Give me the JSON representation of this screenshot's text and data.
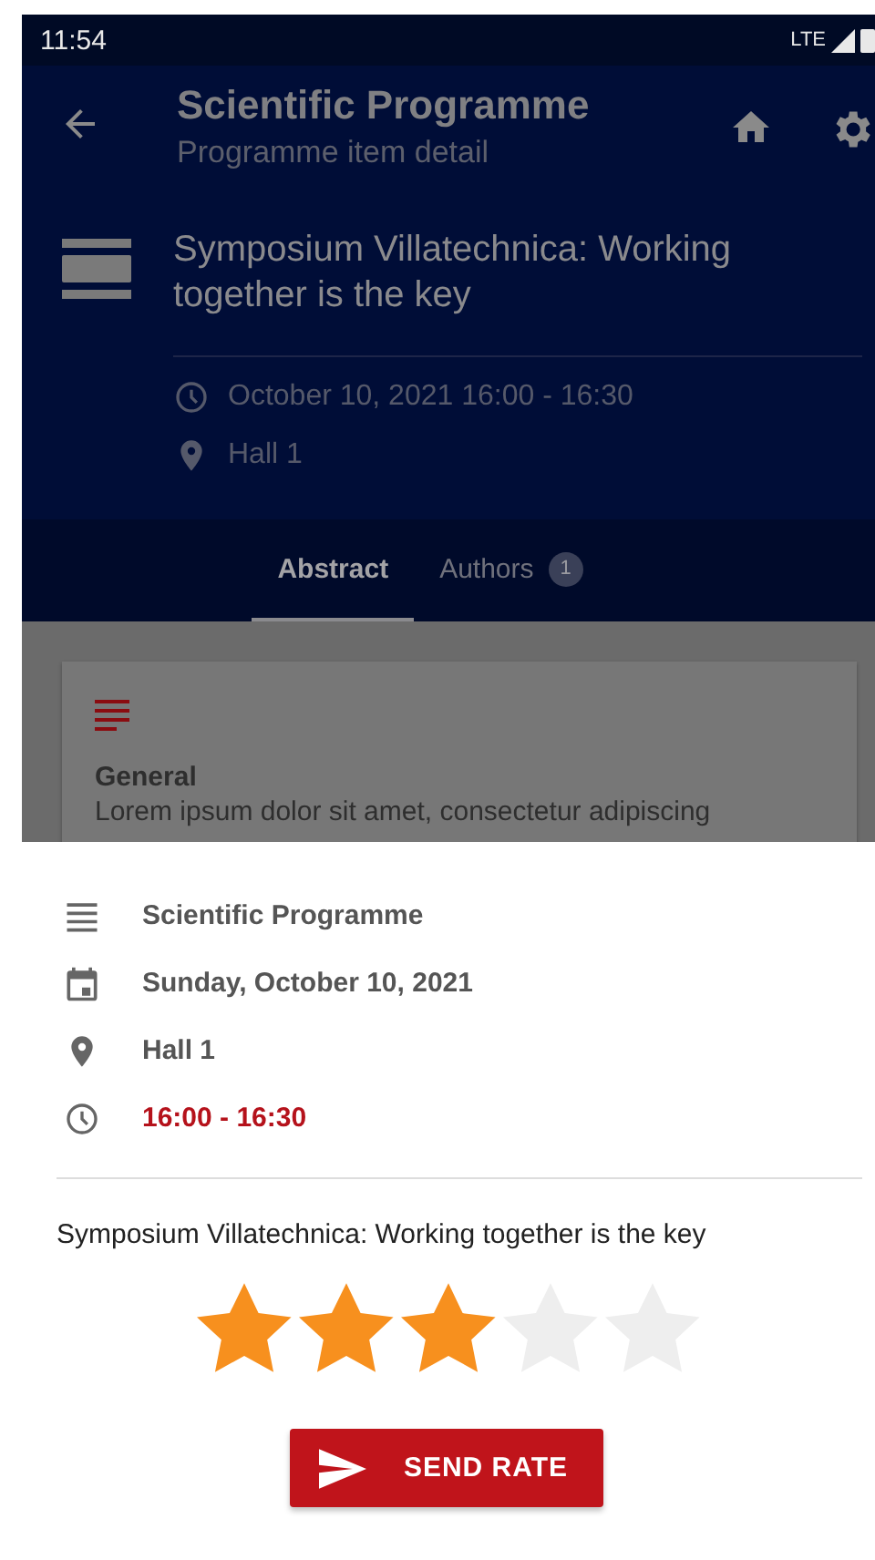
{
  "status_bar": {
    "time": "11:54",
    "network": "LTE"
  },
  "app_bar": {
    "title": "Scientific Programme",
    "subtitle": "Programme item detail"
  },
  "header": {
    "title": "Symposium Villatechnica: Working together is the key",
    "date_time": "October 10, 2021 16:00 - 16:30",
    "location": "Hall 1"
  },
  "tabs": [
    {
      "label": "Abstract",
      "selected": true
    },
    {
      "label": "Authors",
      "selected": false,
      "badge": "1"
    }
  ],
  "card": {
    "heading": "General",
    "text": "Lorem ipsum dolor sit amet, consectetur adipiscing"
  },
  "sheet": {
    "rows": [
      {
        "kind": "programme",
        "text": "Scientific Programme"
      },
      {
        "kind": "date",
        "text": "Sunday, October 10, 2021"
      },
      {
        "kind": "location",
        "text": "Hall 1"
      },
      {
        "kind": "time",
        "text": "16:00 - 16:30"
      }
    ],
    "title": "Symposium Villatechnica: Working together is the key",
    "rating": {
      "stars": 3
    },
    "button": "SEND RATE"
  }
}
